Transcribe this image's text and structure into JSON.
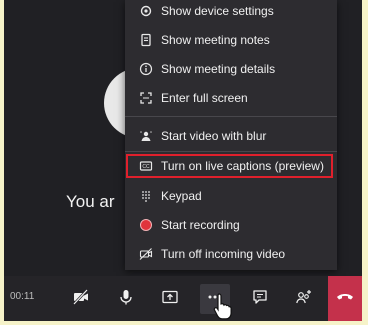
{
  "stage": {
    "caption": "You ar"
  },
  "menu": {
    "items": [
      {
        "label": "Show device settings",
        "icon": "gear-icon"
      },
      {
        "label": "Show meeting notes",
        "icon": "notes-icon"
      },
      {
        "label": "Show meeting details",
        "icon": "info-icon"
      },
      {
        "label": "Enter full screen",
        "icon": "fullscreen-icon"
      },
      {
        "label": "Start video with blur",
        "icon": "blur-icon"
      },
      {
        "label": "Turn on live captions (preview)",
        "icon": "captions-icon"
      },
      {
        "label": "Keypad",
        "icon": "keypad-icon"
      },
      {
        "label": "Start recording",
        "icon": "record-icon"
      },
      {
        "label": "Turn off incoming video",
        "icon": "video-off-icon"
      }
    ]
  },
  "toolbar": {
    "timer": "00:11",
    "buttons": [
      "video-off-icon",
      "microphone-icon",
      "share-screen-icon",
      "more-options-icon",
      "chat-icon",
      "participants-icon"
    ],
    "hangup_icon": "hang-up-icon"
  },
  "colors": {
    "background": "#f6f3c9",
    "frame": "#202024",
    "menu": "#2d2c30",
    "highlight": "#e0202c",
    "record": "#e0343c",
    "hangup": "#c4314b"
  }
}
